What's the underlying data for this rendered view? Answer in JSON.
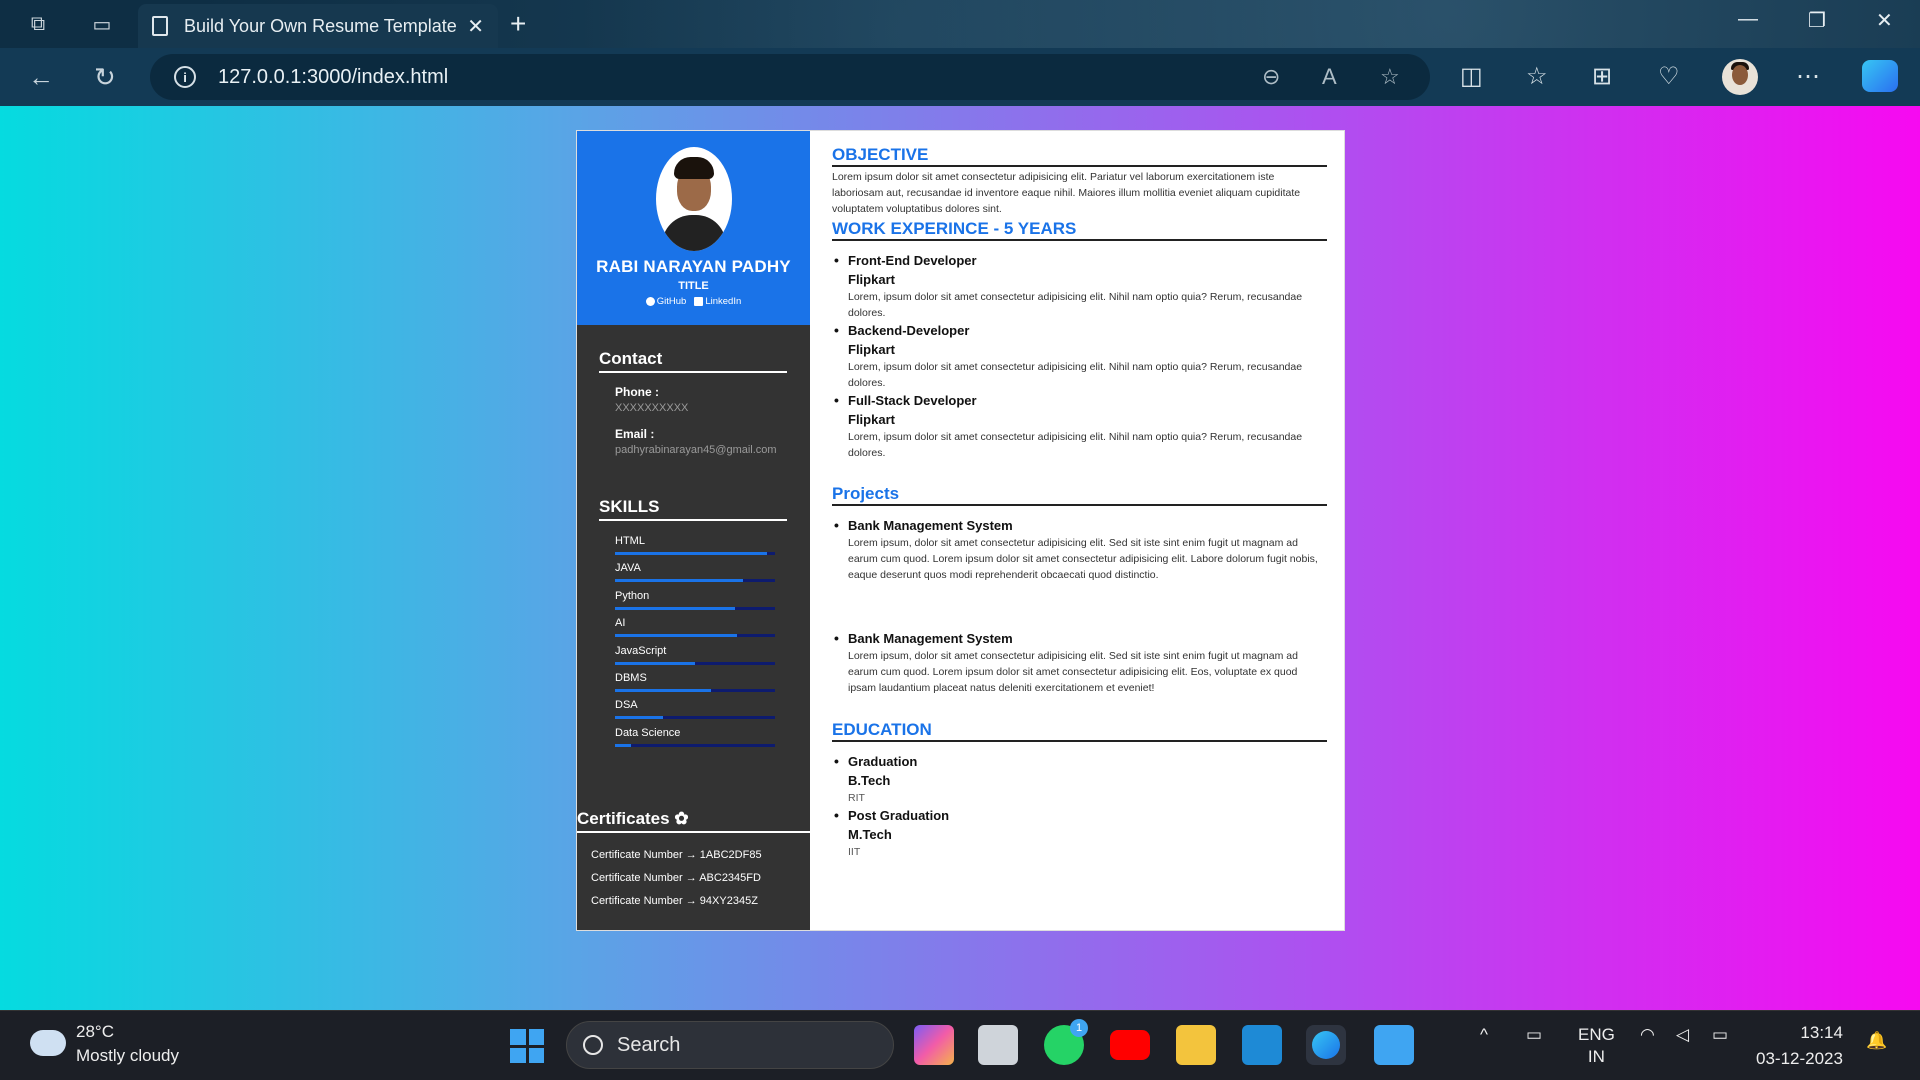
{
  "browser": {
    "tab_title": "Build Your Own Resume Template",
    "url": "127.0.0.1:3000/index.html"
  },
  "resume": {
    "name": "RABI NARAYAN PADHY",
    "title": "TITLE",
    "links": [
      "GitHub",
      "LinkedIn"
    ],
    "contact_heading": "Contact",
    "phone_label": "Phone :",
    "phone_value": "XXXXXXXXXX",
    "email_label": "Email :",
    "email_value": "padhyrabinarayan45@gmail.com",
    "skills_heading": "SKILLS",
    "skills": [
      {
        "name": "HTML",
        "level": 0.95
      },
      {
        "name": "JAVA",
        "level": 0.8
      },
      {
        "name": "Python",
        "level": 0.75
      },
      {
        "name": "AI",
        "level": 0.76
      },
      {
        "name": "JavaScript",
        "level": 0.5
      },
      {
        "name": "DBMS",
        "level": 0.6
      },
      {
        "name": "DSA",
        "level": 0.3
      },
      {
        "name": "Data Science",
        "level": 0.1
      }
    ],
    "certificates_heading": "Certificates",
    "certificates": [
      "Certificate Number → 1ABC2DF85",
      "Certificate Number → ABC2345FD",
      "Certificate Number → 94XY2345Z"
    ],
    "objective_heading": "OBJECTIVE",
    "objective_text": "Lorem ipsum dolor sit amet consectetur adipisicing elit. Pariatur vel laborum exercitationem iste laboriosam aut, recusandae id inventore eaque nihil. Maiores illum mollitia eveniet aliquam cupiditate voluptatem voluptatibus dolores sint.",
    "work_heading": "WORK EXPERINCE - 5 YEARS",
    "work": [
      {
        "role": "Front-End Developer",
        "company": "Flipkart",
        "desc": "Lorem, ipsum dolor sit amet consectetur adipisicing elit. Nihil nam optio quia? Rerum, recusandae dolores."
      },
      {
        "role": "Backend-Developer",
        "company": "Flipkart",
        "desc": "Lorem, ipsum dolor sit amet consectetur adipisicing elit. Nihil nam optio quia? Rerum, recusandae dolores."
      },
      {
        "role": "Full-Stack Developer",
        "company": "Flipkart",
        "desc": "Lorem, ipsum dolor sit amet consectetur adipisicing elit. Nihil nam optio quia? Rerum, recusandae dolores."
      }
    ],
    "projects_heading": "Projects",
    "projects": [
      {
        "name": "Bank Management System",
        "desc": "Lorem ipsum, dolor sit amet consectetur adipisicing elit. Sed sit iste sint enim fugit ut magnam ad earum cum quod. Lorem ipsum dolor sit amet consectetur adipisicing elit. Labore dolorum fugit nobis, eaque deserunt quos modi reprehenderit obcaecati quod distinctio."
      },
      {
        "name": "Bank Management System",
        "desc": "Lorem ipsum, dolor sit amet consectetur adipisicing elit. Sed sit iste sint enim fugit ut magnam ad earum cum quod. Lorem ipsum dolor sit amet consectetur adipisicing elit. Eos, voluptate ex quod ipsam laudantium placeat natus deleniti exercitationem et eveniet!"
      }
    ],
    "education_heading": "EDUCATION",
    "education": [
      {
        "level": "Graduation",
        "degree": "B.Tech",
        "school": "RIT"
      },
      {
        "level": "Post Graduation",
        "degree": "M.Tech",
        "school": "IIT"
      }
    ]
  },
  "taskbar": {
    "temperature": "28°C",
    "weather": "Mostly cloudy",
    "search_placeholder": "Search",
    "whatsapp_badge": "1",
    "lang_top": "ENG",
    "lang_bottom": "IN",
    "time": "13:14",
    "date": "03-12-2023"
  },
  "colors": {
    "accent": "#1a73e8",
    "sidebar": "#333333",
    "bar_track": "#0d1b6e"
  }
}
